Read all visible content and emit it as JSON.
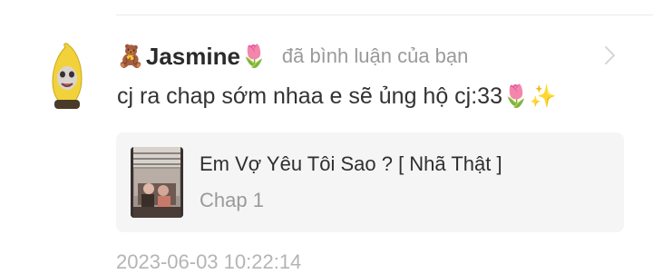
{
  "comment": {
    "user": {
      "badge_emoji": "🧸",
      "name": "Jasmine",
      "name_emoji": "🌷",
      "avatar_icon": "banana-cat-avatar"
    },
    "action_text": "đã bình luận của bạn",
    "text": "cj ra chap sớm nhaa e sẽ ủng hộ cj:33",
    "text_emojis": [
      "🌷",
      "✨"
    ],
    "timestamp": "2023-06-03 10:22:14"
  },
  "linked_chapter": {
    "title": "Em Vợ Yêu Tôi Sao ? [ Nhã Thật ]",
    "chapter": "Chap 1",
    "thumbnail_icon": "manga-cover-thumbnail"
  },
  "colors": {
    "username": "#2b2b2b",
    "secondary_text": "#9a9a9a",
    "card_background": "#f5f5f5",
    "divider": "#e9e9e9"
  }
}
